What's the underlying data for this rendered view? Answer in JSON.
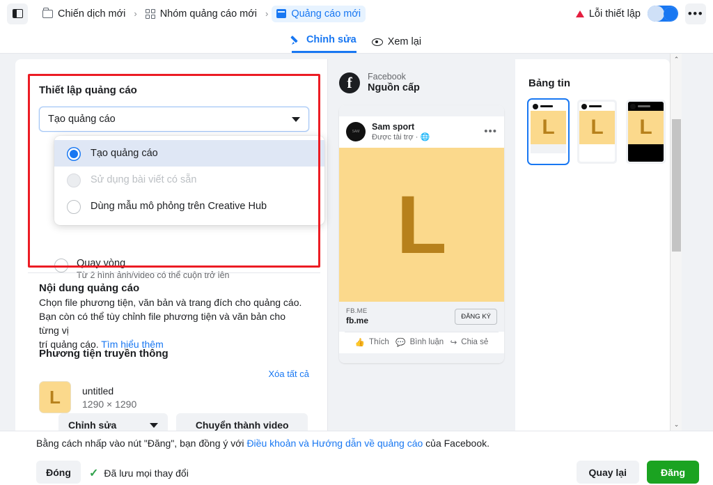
{
  "topbar": {
    "sidebar_toggle_icon": "sidebar-toggle-icon",
    "breadcrumbs": [
      {
        "label": "Chiến dịch mới",
        "icon": "folder-icon",
        "active": false
      },
      {
        "label": "Nhóm quảng cáo mới",
        "icon": "grid-icon",
        "active": false
      },
      {
        "label": "Quảng cáo mới",
        "icon": "ad-icon",
        "active": true
      }
    ],
    "separator": "›",
    "error_label": "Lỗi thiết lập",
    "warning_icon": "warning-triangle-icon",
    "toggle_state": "on",
    "more_icon": "ellipsis-icon",
    "more_label": "•••"
  },
  "tabs": [
    {
      "label": "Chỉnh sửa",
      "icon": "pencil-icon",
      "selected": true
    },
    {
      "label": "Xem lại",
      "icon": "eye-icon",
      "selected": false
    }
  ],
  "left_panel": {
    "setup_title": "Thiết lập quảng cáo",
    "select_value": "Tạo quảng cáo",
    "dropdown_options": [
      {
        "label": "Tạo quảng cáo",
        "state": "selected"
      },
      {
        "label": "Sử dụng bài viết có sẵn",
        "state": "disabled"
      },
      {
        "label": "Dùng mẫu mô phỏng trên Creative Hub",
        "state": "normal"
      }
    ],
    "behind_option": {
      "label": "Quay vòng",
      "sublabel": "Từ 2 hình ảnh/video có thể cuộn trở lên"
    },
    "content_title": "Nội dung quảng cáo",
    "content_desc_1": "Chọn file phương tiện, văn bản và trang đích cho quảng cáo.",
    "content_desc_2": "Bạn còn có thể tùy chỉnh file phương tiện và văn bản cho từng vị",
    "content_desc_3": "trí quảng cáo. ",
    "learn_more": "Tìm hiểu thêm",
    "media_title": "Phương tiện truyền thông",
    "clear_all": "Xóa tất cả",
    "file": {
      "thumb_letter": "L",
      "name": "untitled",
      "dimensions": "1290 × 1290"
    },
    "edit_button": "Chỉnh sửa",
    "convert_button": "Chuyển thành video"
  },
  "preview": {
    "platform": "Facebook",
    "surface": "Nguồn cấp",
    "post": {
      "page_name": "Sam sport",
      "sponsored": "Được tài trợ",
      "globe_icon": "globe-icon",
      "more_icon": "ellipsis-icon",
      "image_letter": "L",
      "cta_domain": "FB.ME",
      "cta_title": "fb.me",
      "cta_button": "ĐĂNG KÝ",
      "actions": [
        {
          "label": "Thích",
          "icon": "thumbs-up-icon"
        },
        {
          "label": "Bình luận",
          "icon": "comment-icon"
        },
        {
          "label": "Chia sẻ",
          "icon": "share-icon"
        }
      ]
    }
  },
  "placements": {
    "title": "Bảng tin",
    "thumbnails": [
      {
        "name": "feed-light-selected",
        "letter": "L",
        "selected": true,
        "theme": "light"
      },
      {
        "name": "feed-light",
        "letter": "L",
        "selected": false,
        "theme": "light"
      },
      {
        "name": "feed-dark",
        "letter": "L",
        "selected": false,
        "theme": "dark"
      }
    ]
  },
  "scrollbar": {
    "up_arrow": "⌃",
    "down_arrow": "⌄"
  },
  "footer": {
    "note_prefix": "Bằng cách nhấp vào nút \"Đăng\", bạn đồng ý với ",
    "note_link": "Điều khoản và Hướng dẫn về quảng cáo",
    "note_suffix": " của Facebook.",
    "close_button": "Đóng",
    "saved_text": "Đã lưu mọi thay đổi",
    "saved_check": "✓",
    "back_button": "Quay lại",
    "post_button": "Đăng"
  },
  "colors": {
    "accent_blue": "#1877f2",
    "error_red": "#e41e3f",
    "success_green": "#31a24c",
    "post_green": "#1ba321",
    "annotation_red": "#ec1c24",
    "media_yellow": "#fbd98c",
    "media_letter": "#b7811c"
  }
}
